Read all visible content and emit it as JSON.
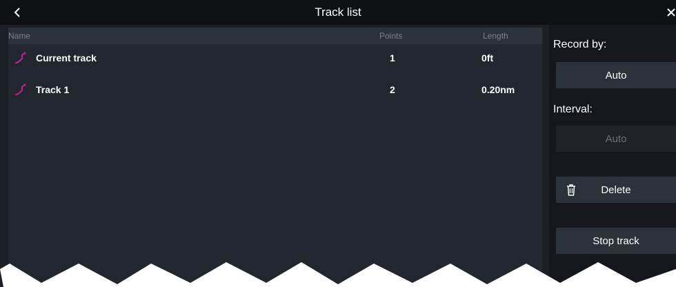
{
  "header": {
    "title": "Track list",
    "back_icon": "chevron-left-icon",
    "close_icon": "close-icon"
  },
  "track_table": {
    "columns": [
      "Name",
      "Points",
      "Length"
    ],
    "rows": [
      {
        "name": "Current track",
        "points": "1",
        "length": "0ft",
        "icon": "track-icon"
      },
      {
        "name": "Track 1",
        "points": "2",
        "length": "0.20nm",
        "icon": "track-icon"
      }
    ]
  },
  "side_panel": {
    "record_by_label": "Record by:",
    "record_by_value": "Auto",
    "interval_label": "Interval:",
    "interval_value": "Auto",
    "delete_label": "Delete",
    "delete_icon": "trash-icon",
    "stop_track_label": "Stop track"
  },
  "colors": {
    "background": "#1c1f26",
    "titlebar": "#0e1014",
    "track_icon": "#c0208c",
    "button": "#2c313a"
  }
}
